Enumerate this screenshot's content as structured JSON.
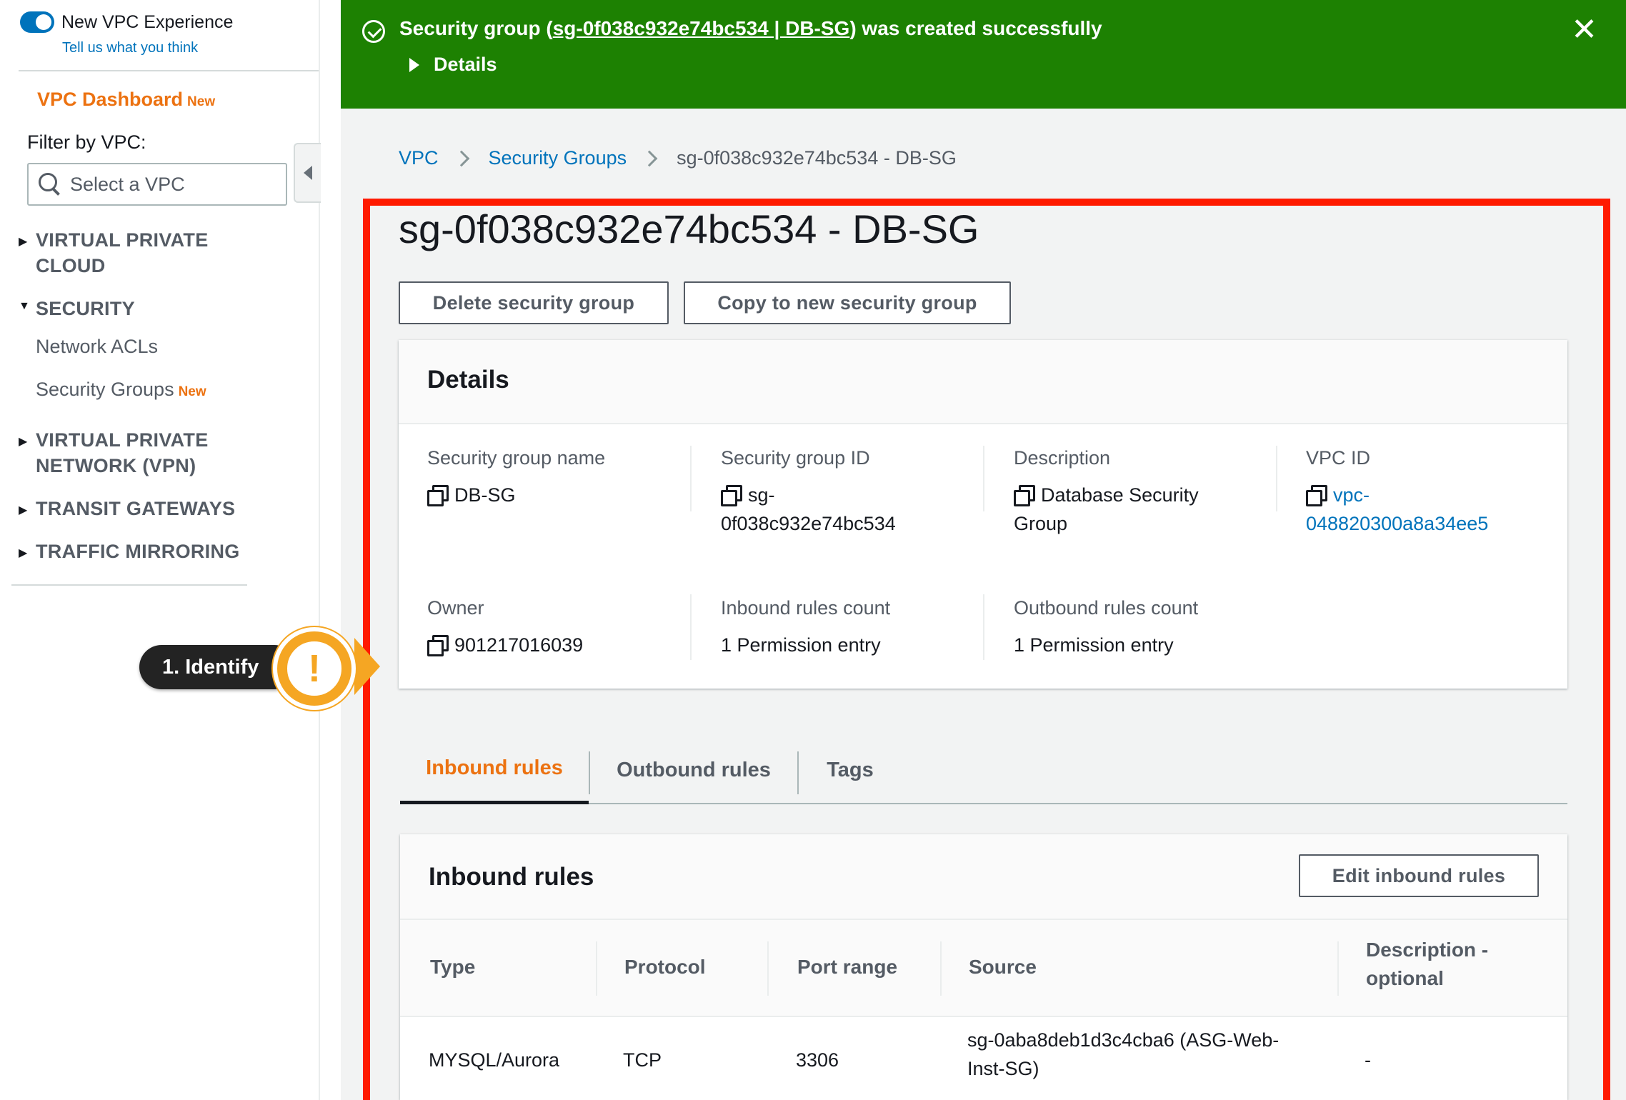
{
  "sidebar": {
    "toggle_label": "New VPC Experience",
    "feedback_link": "Tell us what you think",
    "dashboard_label": "VPC Dashboard",
    "dashboard_badge": "New",
    "filter_label": "Filter by VPC:",
    "vpc_select_placeholder": "Select a VPC",
    "sections": {
      "vpc": {
        "line1": "VIRTUAL PRIVATE",
        "line2": "CLOUD",
        "expanded": false
      },
      "security": {
        "title": "SECURITY",
        "expanded": true
      },
      "vpn": {
        "line1": "VIRTUAL PRIVATE",
        "line2": "NETWORK (VPN)",
        "expanded": false
      },
      "transit": {
        "title": "TRANSIT GATEWAYS",
        "expanded": false
      },
      "mirroring": {
        "title": "TRAFFIC MIRRORING",
        "expanded": false
      }
    },
    "security_items": {
      "network_acls": "Network ACLs",
      "security_groups": "Security Groups",
      "security_groups_badge": "New"
    }
  },
  "flash": {
    "prefix": "Security group (",
    "link": "sg-0f038c932e74bc534 | DB-SG",
    "suffix": ") was created successfully",
    "details_label": "Details",
    "close_glyph": "✕",
    "color": "#1d8102"
  },
  "breadcrumb": {
    "root": "VPC",
    "parent": "Security Groups",
    "current": "sg-0f038c932e74bc534 - DB-SG"
  },
  "page": {
    "title": "sg-0f038c932e74bc534 - DB-SG",
    "delete_button": "Delete security group",
    "copy_button": "Copy to new security group"
  },
  "details": {
    "title": "Details",
    "sg_name_label": "Security group name",
    "sg_name_value": "DB-SG",
    "sg_id_label": "Security group ID",
    "sg_id_line1": "sg-",
    "sg_id_line2": "0f038c932e74bc534",
    "description_label": "Description",
    "description_line1": "Database Security",
    "description_line2": "Group",
    "vpc_id_label": "VPC ID",
    "vpc_id_line1": "vpc-",
    "vpc_id_line2": "048820300a8a34ee5",
    "owner_label": "Owner",
    "owner_value": "901217016039",
    "inbound_count_label": "Inbound rules count",
    "inbound_count_value": "1 Permission entry",
    "outbound_count_label": "Outbound rules count",
    "outbound_count_value": "1 Permission entry"
  },
  "tabs": {
    "inbound": "Inbound rules",
    "outbound": "Outbound rules",
    "tags": "Tags",
    "active": "inbound"
  },
  "inbound_rules": {
    "title": "Inbound rules",
    "edit_button": "Edit inbound rules",
    "columns": {
      "type": "Type",
      "protocol": "Protocol",
      "port_range": "Port range",
      "source": "Source",
      "description_line1": "Description -",
      "description_line2": "optional"
    },
    "rows": [
      {
        "type": "MYSQL/Aurora",
        "protocol": "TCP",
        "port_range": "3306",
        "source_line1": "sg-0aba8deb1d3c4cba6 (ASG-Web-",
        "source_line2": "Inst-SG)",
        "description": "-"
      }
    ]
  },
  "callout": {
    "label": "1. Identify",
    "glyph": "!",
    "color": "#f5a623"
  },
  "colors": {
    "accent_orange": "#ec7211",
    "link_blue": "#0073bb",
    "highlight_red": "#ff1a00",
    "success_green": "#1d8102"
  }
}
